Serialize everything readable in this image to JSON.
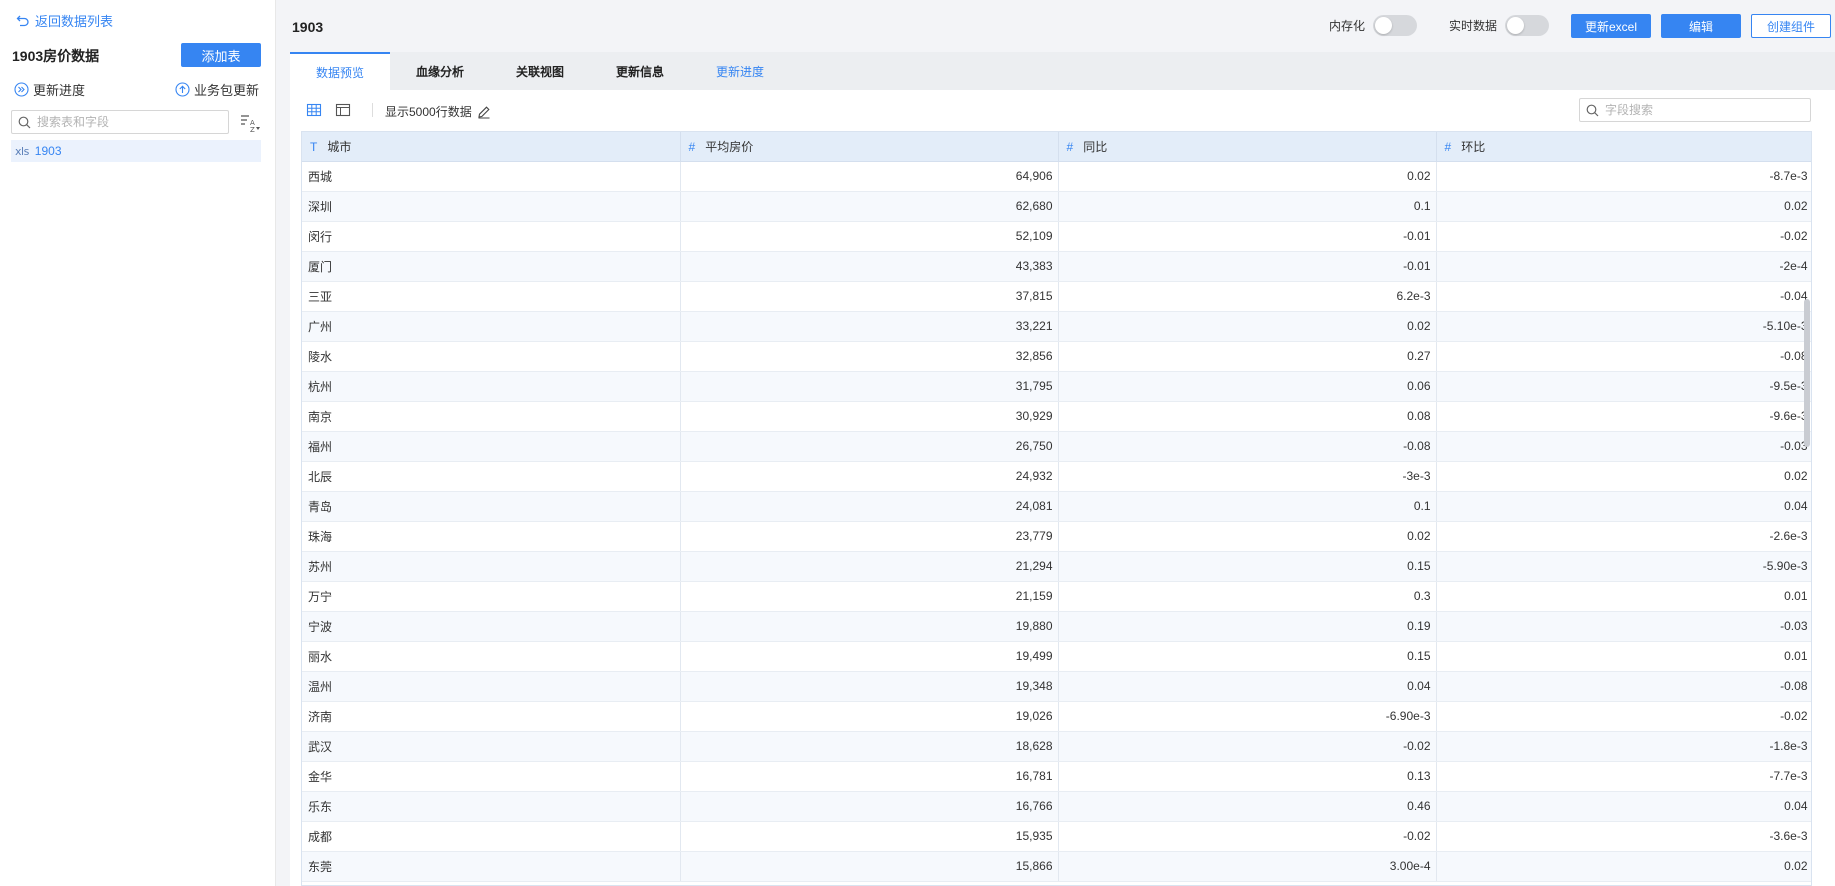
{
  "sidebar": {
    "back_label": "返回数据列表",
    "package_title": "1903房价数据",
    "add_table_label": "添加表",
    "update_progress_label": "更新进度",
    "package_update_label": "业务包更新",
    "search_placeholder": "搜索表和字段",
    "tree_items": [
      {
        "type_badge": "xls",
        "label": "1903"
      }
    ]
  },
  "header": {
    "title": "1903",
    "in_memory_label": "内存化",
    "in_memory_on": false,
    "realtime_label": "实时数据",
    "realtime_on": false,
    "update_excel_label": "更新excel",
    "edit_label": "编辑",
    "create_component_label": "创建组件"
  },
  "tabs": [
    {
      "label": "数据预览",
      "active": true
    },
    {
      "label": "血缘分析"
    },
    {
      "label": "关联视图"
    },
    {
      "label": "更新信息"
    },
    {
      "label": "更新进度",
      "link": true
    }
  ],
  "toolbar": {
    "rows_label": "显示5000行数据",
    "field_search_placeholder": "字段搜索"
  },
  "table": {
    "columns": [
      {
        "type": "T",
        "label": "城市"
      },
      {
        "type": "#",
        "label": "平均房价"
      },
      {
        "type": "#",
        "label": "同比"
      },
      {
        "type": "#",
        "label": "环比"
      }
    ],
    "rows": [
      [
        "西城",
        "64,906",
        "0.02",
        "-8.7e-3"
      ],
      [
        "深圳",
        "62,680",
        "0.1",
        "0.02"
      ],
      [
        "闵行",
        "52,109",
        "-0.01",
        "-0.02"
      ],
      [
        "厦门",
        "43,383",
        "-0.01",
        "-2e-4"
      ],
      [
        "三亚",
        "37,815",
        "6.2e-3",
        "-0.04"
      ],
      [
        "广州",
        "33,221",
        "0.02",
        "-5.10e-3"
      ],
      [
        "陵水",
        "32,856",
        "0.27",
        "-0.08"
      ],
      [
        "杭州",
        "31,795",
        "0.06",
        "-9.5e-3"
      ],
      [
        "南京",
        "30,929",
        "0.08",
        "-9.6e-3"
      ],
      [
        "福州",
        "26,750",
        "-0.08",
        "-0.03"
      ],
      [
        "北辰",
        "24,932",
        "-3e-3",
        "0.02"
      ],
      [
        "青岛",
        "24,081",
        "0.1",
        "0.04"
      ],
      [
        "珠海",
        "23,779",
        "0.02",
        "-2.6e-3"
      ],
      [
        "苏州",
        "21,294",
        "0.15",
        "-5.90e-3"
      ],
      [
        "万宁",
        "21,159",
        "0.3",
        "0.01"
      ],
      [
        "宁波",
        "19,880",
        "0.19",
        "-0.03"
      ],
      [
        "丽水",
        "19,499",
        "0.15",
        "0.01"
      ],
      [
        "温州",
        "19,348",
        "0.04",
        "-0.08"
      ],
      [
        "济南",
        "19,026",
        "-6.90e-3",
        "-0.02"
      ],
      [
        "武汉",
        "18,628",
        "-0.02",
        "-1.8e-3"
      ],
      [
        "金华",
        "16,781",
        "0.13",
        "-7.7e-3"
      ],
      [
        "乐东",
        "16,766",
        "0.46",
        "0.04"
      ],
      [
        "成都",
        "15,935",
        "-0.02",
        "-3.6e-3"
      ],
      [
        "东莞",
        "15,866",
        "3.00e-4",
        "0.02"
      ]
    ]
  },
  "colors": {
    "accent": "#3685f2",
    "header_bg": "#e3edf9",
    "page_bg": "#f3f4f7"
  }
}
